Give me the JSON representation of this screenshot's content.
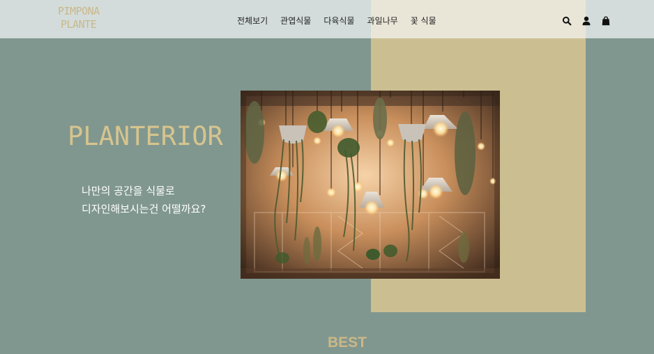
{
  "brand": {
    "logo_line1": "PIMPONA",
    "logo_line2": "PLANTE"
  },
  "nav": {
    "items": [
      "전체보기",
      "관엽식물",
      "다육식물",
      "과일나무",
      "꽃 식물"
    ]
  },
  "header_icons": [
    "search-icon",
    "user-icon",
    "shopping-bag-icon"
  ],
  "hero": {
    "title": "PLANTERIOR",
    "subtitle_line1": "나만의 공간을 식물로",
    "subtitle_line2": "디자인해보시는건 어떨까요?"
  },
  "section": {
    "best_label": "BEST"
  },
  "colors": {
    "background": "#80978f",
    "accent_tan": "#cbbf92",
    "logo": "#c9b88a",
    "title": "#d6c48e"
  }
}
